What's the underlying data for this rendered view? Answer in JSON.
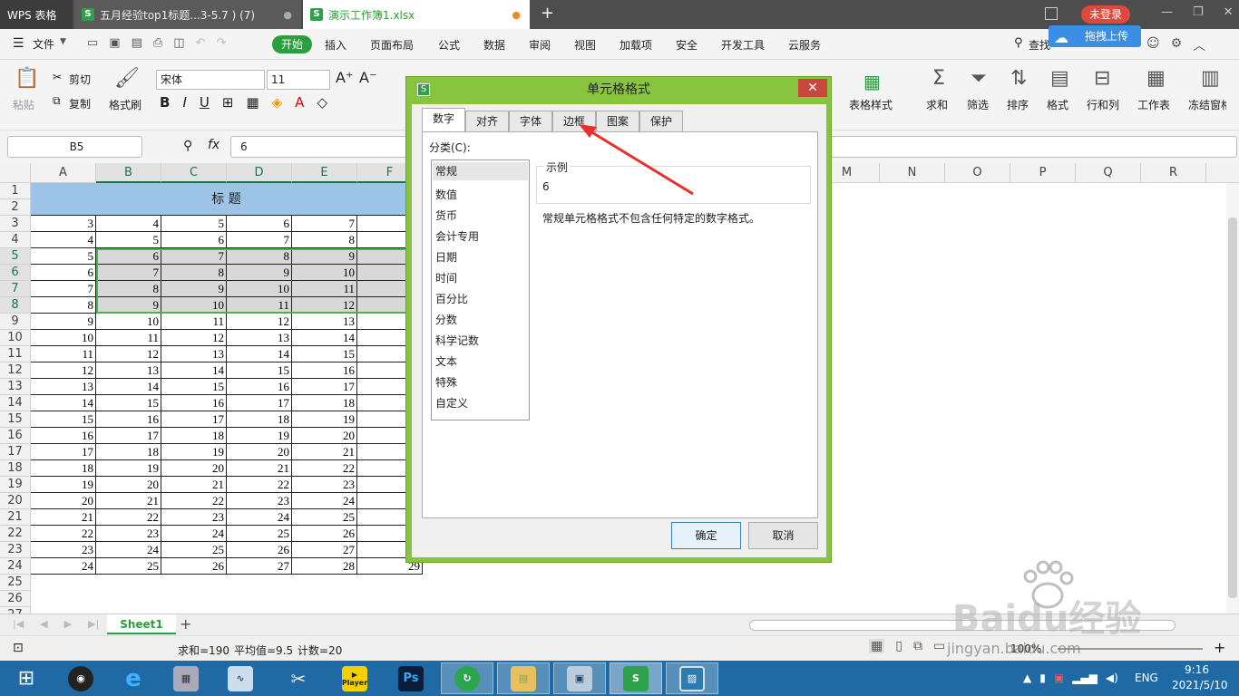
{
  "titlebar": {
    "app_label": "WPS 表格",
    "tab1": "五月经验top1标题...3-5.7 ) (7)",
    "tab2": "演示工作簿1.xlsx",
    "login": "未登录"
  },
  "menubar": {
    "file": "文件",
    "items": [
      "开始",
      "插入",
      "页面布局",
      "公式",
      "数据",
      "审阅",
      "视图",
      "加载项",
      "安全",
      "开发工具",
      "云服务"
    ],
    "search": "查找",
    "upload": "拖拽上传"
  },
  "ribbon": {
    "paste": "粘贴",
    "cut": "剪切",
    "copy": "复制",
    "format_painter": "格式刷",
    "font_name": "宋体",
    "font_size": "11",
    "table_style": "表格样式",
    "sum": "求和",
    "filter": "筛选",
    "sort": "排序",
    "format": "格式",
    "rowcol": "行和列",
    "worksheet": "工作表",
    "freeze": "冻结窗格"
  },
  "formula_bar": {
    "name_box": "B5",
    "fx": "fx",
    "value": "6"
  },
  "columns": [
    "A",
    "B",
    "C",
    "D",
    "E",
    "F",
    "M",
    "N",
    "O",
    "P",
    "Q",
    "R"
  ],
  "selected_columns": [
    "B",
    "C",
    "D",
    "E",
    "F"
  ],
  "rows": [
    "1",
    "2",
    "3",
    "4",
    "5",
    "6",
    "7",
    "8",
    "9",
    "10",
    "11",
    "12",
    "13",
    "14",
    "15",
    "16",
    "17",
    "18",
    "19",
    "20",
    "21",
    "22",
    "23",
    "24",
    "25",
    "26",
    "27"
  ],
  "selected_rows": [
    "5",
    "6",
    "7",
    "8"
  ],
  "header_title": "标 题",
  "table_rows": [
    [
      3,
      4,
      5,
      6,
      7
    ],
    [
      4,
      5,
      6,
      7,
      8
    ],
    [
      5,
      6,
      7,
      8,
      9
    ],
    [
      6,
      7,
      8,
      9,
      10
    ],
    [
      7,
      8,
      9,
      10,
      11
    ],
    [
      8,
      9,
      10,
      11,
      12
    ],
    [
      9,
      10,
      11,
      12,
      13
    ],
    [
      10,
      11,
      12,
      13,
      14
    ],
    [
      11,
      12,
      13,
      14,
      15
    ],
    [
      12,
      13,
      14,
      15,
      16
    ],
    [
      13,
      14,
      15,
      16,
      17
    ],
    [
      14,
      15,
      16,
      17,
      18
    ],
    [
      15,
      16,
      17,
      18,
      19
    ],
    [
      16,
      17,
      18,
      19,
      20
    ],
    [
      17,
      18,
      19,
      20,
      21
    ],
    [
      18,
      19,
      20,
      21,
      22
    ],
    [
      19,
      20,
      21,
      22,
      23
    ],
    [
      20,
      21,
      22,
      23,
      24
    ],
    [
      21,
      22,
      23,
      24,
      25
    ],
    [
      22,
      23,
      24,
      25,
      26
    ],
    [
      23,
      24,
      25,
      26,
      27
    ],
    [
      24,
      25,
      26,
      27,
      28
    ]
  ],
  "visible_f24": "29",
  "dialog": {
    "title": "单元格格式",
    "tabs": [
      "数字",
      "对齐",
      "字体",
      "边框",
      "图案",
      "保护"
    ],
    "active_tab": "数字",
    "category_label": "分类(C):",
    "categories": [
      "常规",
      "数值",
      "货币",
      "会计专用",
      "日期",
      "时间",
      "百分比",
      "分数",
      "科学记数",
      "文本",
      "特殊",
      "自定义"
    ],
    "selected_category": "常规",
    "sample_label": "示例",
    "sample_value": "6",
    "description": "常规单元格格式不包含任何特定的数字格式。",
    "ok": "确定",
    "cancel": "取消"
  },
  "sheet": {
    "tab": "Sheet1",
    "add": "+"
  },
  "status": {
    "sum": "求和=190",
    "avg": "平均值=9.5",
    "count": "计数=20",
    "zoom": "100%"
  },
  "watermark": {
    "brand": "Baidu经验",
    "url": "jingyan.baidu.com"
  },
  "taskbar": {
    "lang": "ENG",
    "time": "9:16",
    "date": "2021/5/10",
    "player": "Player",
    "ps": "Ps"
  },
  "colors": {
    "accent_green": "#2a9f3d",
    "dialog_frame": "#88c440",
    "header_blue": "#9dc3e6",
    "close_red": "#c9463d",
    "arrow_red": "#e8302d"
  }
}
